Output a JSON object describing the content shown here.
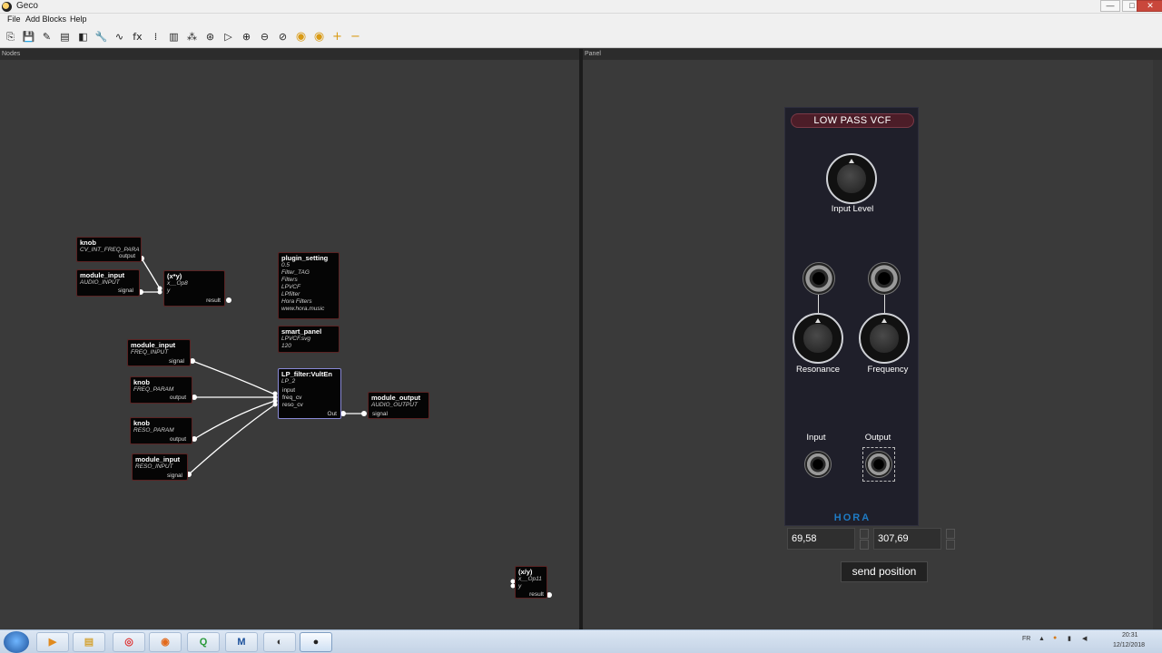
{
  "window": {
    "title": "Geco",
    "min": "—",
    "max": "□",
    "close": "✕"
  },
  "menu": [
    "File",
    "Add Blocks",
    "Help"
  ],
  "toolbar": {
    "buttons": [
      "⎘",
      "💾",
      "✎",
      "▤",
      "◧",
      "🔧",
      "∿",
      "fx",
      "⁞",
      "▥",
      "⁂",
      "⊛",
      "▷",
      "⊕",
      "⊖",
      "⊘",
      "◉",
      "◉",
      "+",
      "−"
    ]
  },
  "panes": {
    "nodes": "Nodes",
    "panel": "Panel"
  },
  "nodes": [
    {
      "id": "knob1",
      "title": "knob",
      "sub": [
        "CV_INT_FREQ_PARA"
      ],
      "ports": [
        "output"
      ]
    },
    {
      "id": "modin1",
      "title": "module_input",
      "sub": [
        "AUDIO_INPUT"
      ],
      "ports": [
        "signal"
      ]
    },
    {
      "id": "mul",
      "title": "(x*y)",
      "sub": [
        "x__Op8",
        "y"
      ],
      "ports": [
        "result"
      ]
    },
    {
      "id": "plugin",
      "title": "plugin_setting",
      "sub": [
        "0.5",
        "Filter_TAG",
        "Filters",
        "LPVCF",
        "LPfilter",
        "Hora Filters",
        "www.hora.music"
      ]
    },
    {
      "id": "smart",
      "title": "smart_panel",
      "sub": [
        "LPVCF.svg",
        "120"
      ]
    },
    {
      "id": "modin2",
      "title": "module_input",
      "sub": [
        "FREQ_INPUT"
      ],
      "ports": [
        "signal"
      ]
    },
    {
      "id": "lp",
      "title": "LP_filter:VultEn",
      "sub": [
        "LP_2",
        "input",
        "freq_cv",
        "reso_cv"
      ],
      "ports": [
        "Out"
      ]
    },
    {
      "id": "modout",
      "title": "module_output",
      "sub": [
        "AUDIO_OUTPUT"
      ],
      "ports": [
        "signal"
      ]
    },
    {
      "id": "knob2",
      "title": "knob",
      "sub": [
        "FREQ_PARAM"
      ],
      "ports": [
        "output"
      ]
    },
    {
      "id": "knob3",
      "title": "knob",
      "sub": [
        "RESO_PARAM"
      ],
      "ports": [
        "output"
      ]
    },
    {
      "id": "modin3",
      "title": "module_input",
      "sub": [
        "RESO_INPUT"
      ],
      "ports": [
        "signal"
      ]
    },
    {
      "id": "div",
      "title": "(x/y)",
      "sub": [
        "x__Op11",
        "y"
      ],
      "ports": [
        "result"
      ]
    }
  ],
  "module": {
    "title": "LOW PASS VCF",
    "input_level": "Input Level",
    "resonance": "Resonance",
    "frequency": "Frequency",
    "input": "Input",
    "output": "Output",
    "brand": "HORA"
  },
  "position": {
    "x": "69,58",
    "y": "307,69",
    "send_label": "send position"
  },
  "tray": {
    "lang": "FR",
    "time": "20:31",
    "date": "12/12/2018"
  }
}
